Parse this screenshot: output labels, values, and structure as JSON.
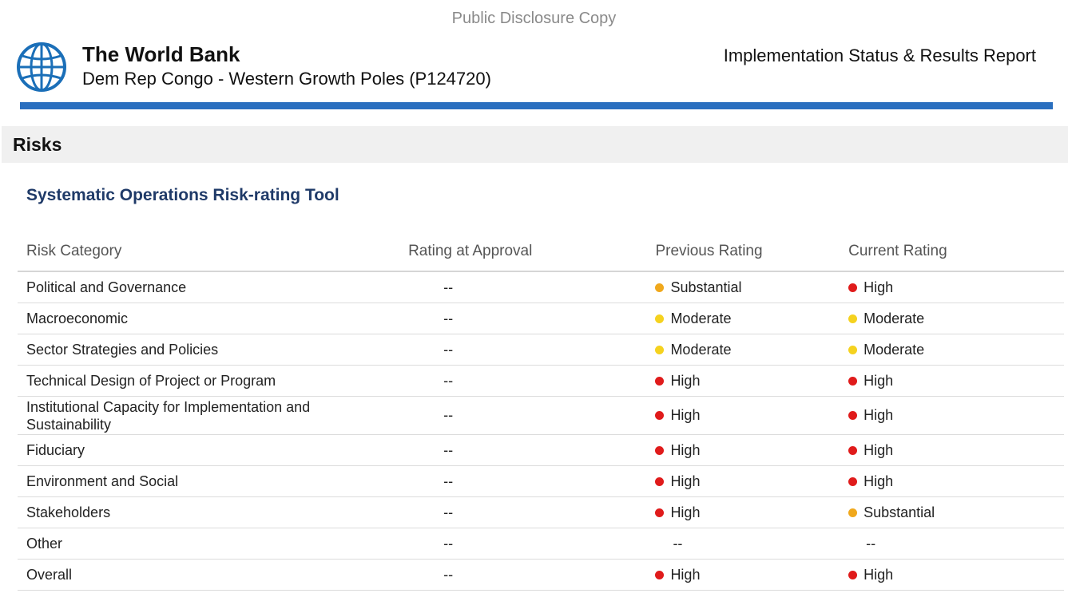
{
  "header": {
    "disclosure": "Public Disclosure Copy",
    "organization": "The World Bank",
    "project": "Dem Rep Congo - Western Growth Poles (P124720)",
    "report_title": "Implementation Status & Results Report",
    "logo_icon": "world-bank-globe-icon"
  },
  "section": {
    "title": "Risks",
    "subtitle": "Systematic Operations Risk-rating Tool"
  },
  "colors": {
    "High": "#e01b1b",
    "Substantial": "#f0a81c",
    "Moderate": "#f5d21f",
    "accent_rule": "#2a6fbf",
    "subtitle": "#1f3a68"
  },
  "table": {
    "headers": [
      "Risk Category",
      "Rating at Approval",
      "Previous Rating",
      "Current Rating"
    ],
    "rows": [
      {
        "category": "Political and Governance",
        "approval": "--",
        "previous": "Substantial",
        "current": "High"
      },
      {
        "category": "Macroeconomic",
        "approval": "--",
        "previous": "Moderate",
        "current": "Moderate"
      },
      {
        "category": "Sector Strategies and Policies",
        "approval": "--",
        "previous": "Moderate",
        "current": "Moderate"
      },
      {
        "category": "Technical Design of Project or Program",
        "approval": "--",
        "previous": "High",
        "current": "High"
      },
      {
        "category": "Institutional Capacity for Implementation and Sustainability",
        "approval": "--",
        "previous": "High",
        "current": "High"
      },
      {
        "category": "Fiduciary",
        "approval": "--",
        "previous": "High",
        "current": "High"
      },
      {
        "category": "Environment and Social",
        "approval": "--",
        "previous": "High",
        "current": "High"
      },
      {
        "category": "Stakeholders",
        "approval": "--",
        "previous": "High",
        "current": "Substantial"
      },
      {
        "category": "Other",
        "approval": "--",
        "previous": "--",
        "current": "--"
      },
      {
        "category": "Overall",
        "approval": "--",
        "previous": "High",
        "current": "High"
      }
    ]
  }
}
